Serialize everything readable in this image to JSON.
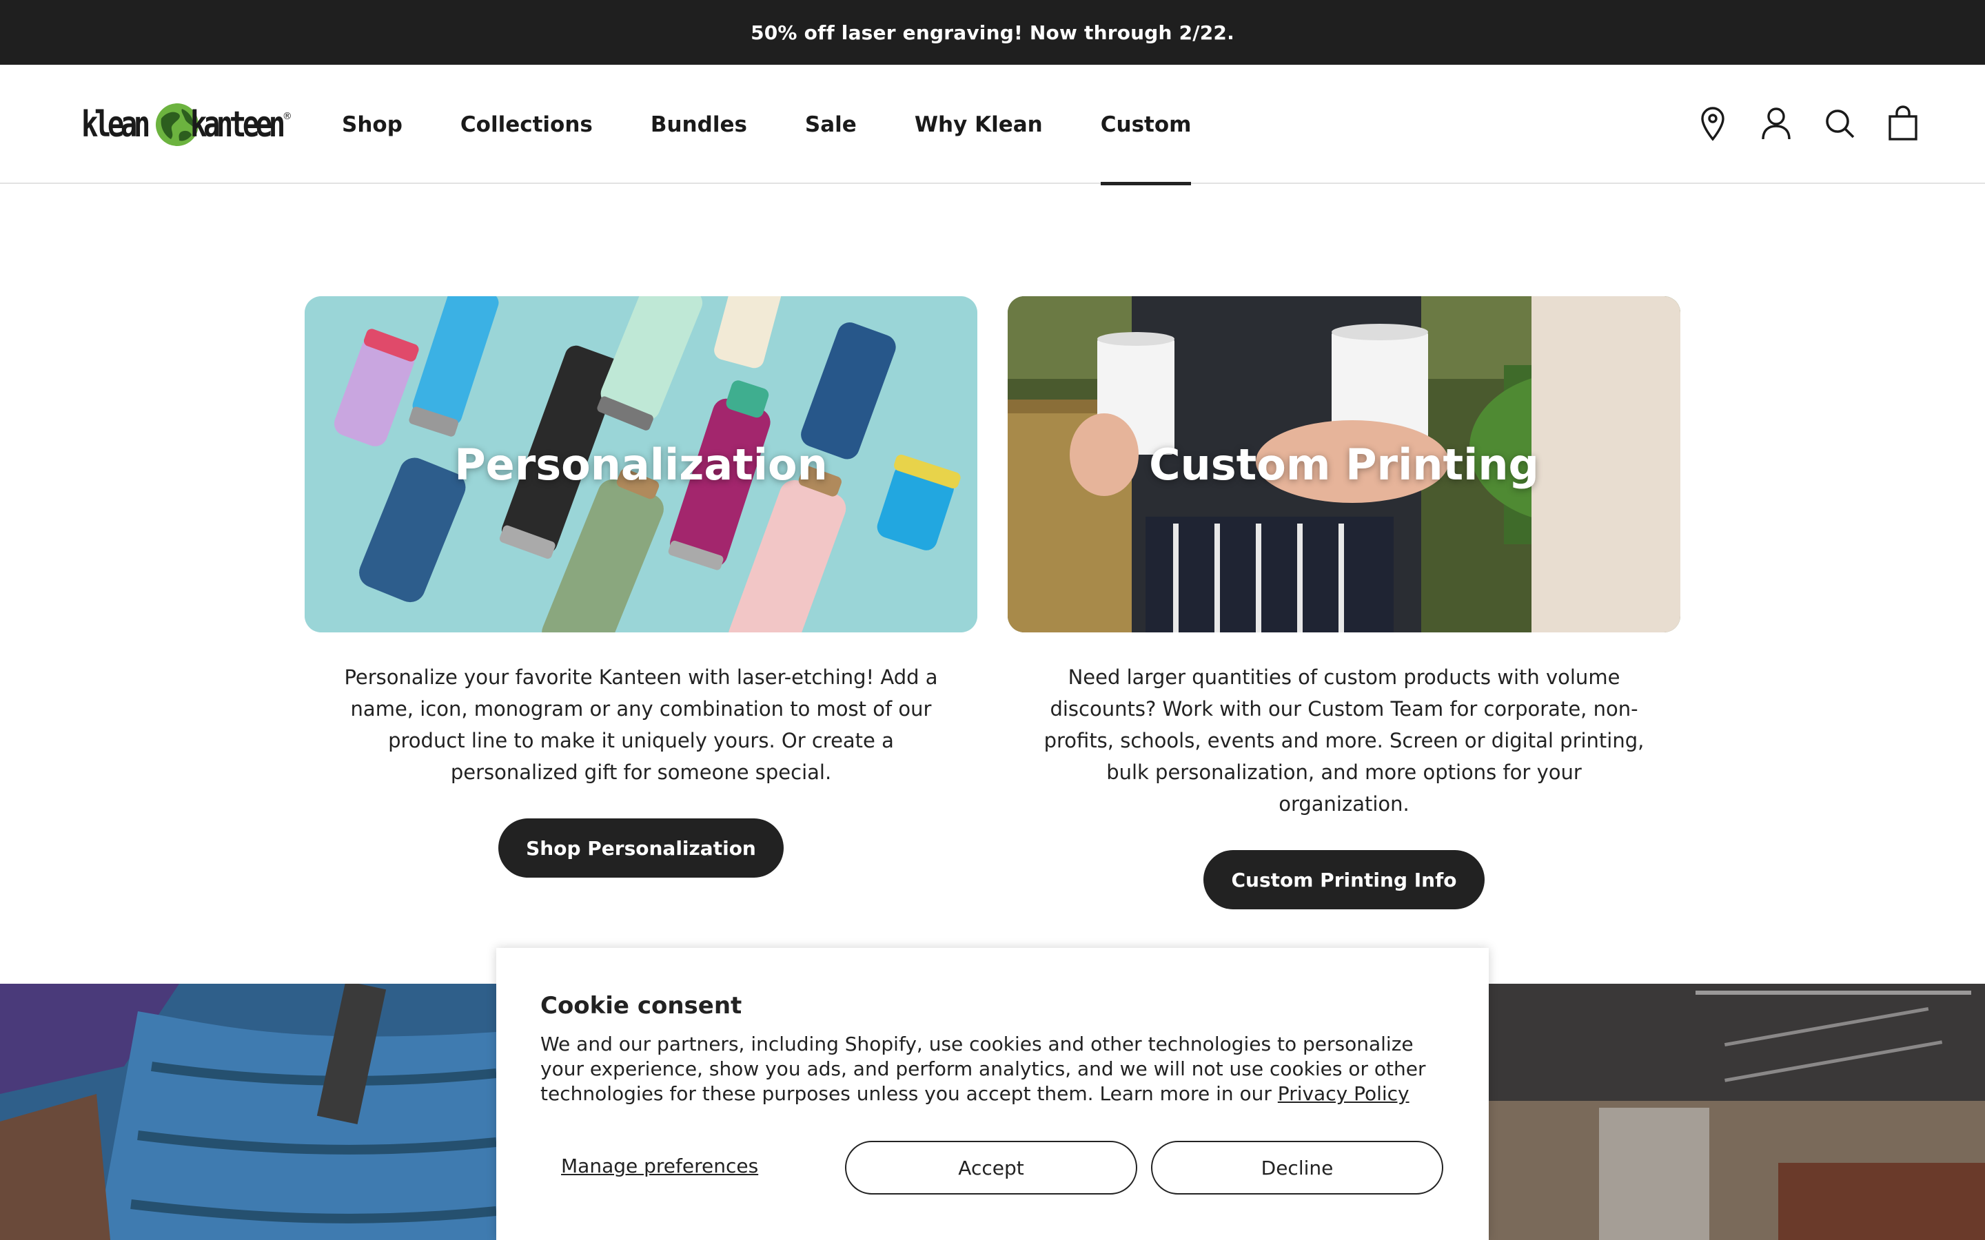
{
  "announcement": {
    "text": "50% off laser engraving! Now through 2/22."
  },
  "logo": {
    "part1": "klean",
    "part2": "kanteen",
    "reg": "®"
  },
  "nav": {
    "items": [
      {
        "label": "Shop"
      },
      {
        "label": "Collections"
      },
      {
        "label": "Bundles"
      },
      {
        "label": "Sale"
      },
      {
        "label": "Why Klean"
      },
      {
        "label": "Custom",
        "active": true
      }
    ]
  },
  "header_icons": [
    "location-pin-icon",
    "account-icon",
    "search-icon",
    "cart-bag-icon"
  ],
  "cards": [
    {
      "title": "Personalization",
      "description": "Personalize your favorite Kanteen with laser-etching! Add a name, icon, monogram or any combination to most of our product line to make it uniquely yours. Or create a personalized gift for someone special.",
      "button": "Shop Personalization"
    },
    {
      "title": "Custom Printing",
      "description": "Need larger quantities of custom products with volume discounts? Work with our Custom Team for corporate, non-profits, schools, events and more. Screen or digital printing, bulk personalization, and more options for your organization.",
      "button": "Custom Printing Info"
    }
  ],
  "cookie": {
    "title": "Cookie consent",
    "body": "We and our partners, including Shopify, use cookies and other technologies to personalize your experience, show you ads, and perform analytics, and we will not use cookies or other technologies for these purposes unless you accept them. Learn more in our ",
    "link": "Privacy Policy",
    "manage": "Manage preferences",
    "accept": "Accept",
    "decline": "Decline"
  },
  "colors": {
    "dark": "#1f1f1f",
    "text": "#222222",
    "logo_green": "#6cb33f"
  }
}
